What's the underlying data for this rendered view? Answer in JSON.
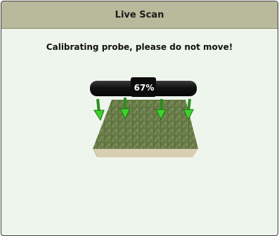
{
  "window": {
    "title": "Live Scan"
  },
  "main": {
    "message": "Calibrating probe, please do not move!"
  },
  "calibration": {
    "progress_label": "67%",
    "progress": 0.67
  },
  "colors": {
    "titlebar": "#b9b99b",
    "background": "#eef5ec",
    "probe": "#111111",
    "arrow": "#3cd22d",
    "grass": "#6c7f4a",
    "soil": "#d8cfb2"
  },
  "icons": {
    "probe": "probe-bar-icon",
    "arrow": "down-arrow-icon",
    "sample": "grass-sample-icon"
  }
}
